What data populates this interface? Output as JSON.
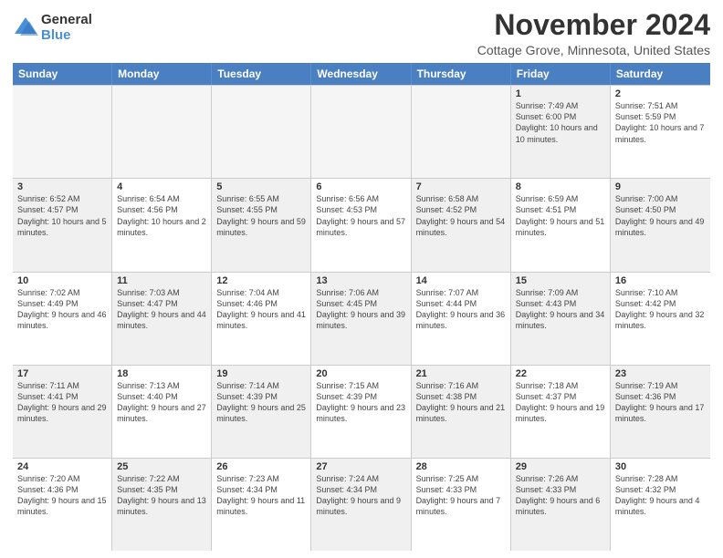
{
  "header": {
    "logo_general": "General",
    "logo_blue": "Blue",
    "month_title": "November 2024",
    "location": "Cottage Grove, Minnesota, United States"
  },
  "days_of_week": [
    "Sunday",
    "Monday",
    "Tuesday",
    "Wednesday",
    "Thursday",
    "Friday",
    "Saturday"
  ],
  "rows": [
    [
      {
        "day": "",
        "info": "",
        "empty": true
      },
      {
        "day": "",
        "info": "",
        "empty": true
      },
      {
        "day": "",
        "info": "",
        "empty": true
      },
      {
        "day": "",
        "info": "",
        "empty": true
      },
      {
        "day": "",
        "info": "",
        "empty": true
      },
      {
        "day": "1",
        "info": "Sunrise: 7:49 AM\nSunset: 6:00 PM\nDaylight: 10 hours and 10 minutes.",
        "shaded": true
      },
      {
        "day": "2",
        "info": "Sunrise: 7:51 AM\nSunset: 5:59 PM\nDaylight: 10 hours and 7 minutes.",
        "shaded": false
      }
    ],
    [
      {
        "day": "3",
        "info": "Sunrise: 6:52 AM\nSunset: 4:57 PM\nDaylight: 10 hours and 5 minutes.",
        "shaded": true
      },
      {
        "day": "4",
        "info": "Sunrise: 6:54 AM\nSunset: 4:56 PM\nDaylight: 10 hours and 2 minutes.",
        "shaded": false
      },
      {
        "day": "5",
        "info": "Sunrise: 6:55 AM\nSunset: 4:55 PM\nDaylight: 9 hours and 59 minutes.",
        "shaded": true
      },
      {
        "day": "6",
        "info": "Sunrise: 6:56 AM\nSunset: 4:53 PM\nDaylight: 9 hours and 57 minutes.",
        "shaded": false
      },
      {
        "day": "7",
        "info": "Sunrise: 6:58 AM\nSunset: 4:52 PM\nDaylight: 9 hours and 54 minutes.",
        "shaded": true
      },
      {
        "day": "8",
        "info": "Sunrise: 6:59 AM\nSunset: 4:51 PM\nDaylight: 9 hours and 51 minutes.",
        "shaded": false
      },
      {
        "day": "9",
        "info": "Sunrise: 7:00 AM\nSunset: 4:50 PM\nDaylight: 9 hours and 49 minutes.",
        "shaded": true
      }
    ],
    [
      {
        "day": "10",
        "info": "Sunrise: 7:02 AM\nSunset: 4:49 PM\nDaylight: 9 hours and 46 minutes.",
        "shaded": false
      },
      {
        "day": "11",
        "info": "Sunrise: 7:03 AM\nSunset: 4:47 PM\nDaylight: 9 hours and 44 minutes.",
        "shaded": true
      },
      {
        "day": "12",
        "info": "Sunrise: 7:04 AM\nSunset: 4:46 PM\nDaylight: 9 hours and 41 minutes.",
        "shaded": false
      },
      {
        "day": "13",
        "info": "Sunrise: 7:06 AM\nSunset: 4:45 PM\nDaylight: 9 hours and 39 minutes.",
        "shaded": true
      },
      {
        "day": "14",
        "info": "Sunrise: 7:07 AM\nSunset: 4:44 PM\nDaylight: 9 hours and 36 minutes.",
        "shaded": false
      },
      {
        "day": "15",
        "info": "Sunrise: 7:09 AM\nSunset: 4:43 PM\nDaylight: 9 hours and 34 minutes.",
        "shaded": true
      },
      {
        "day": "16",
        "info": "Sunrise: 7:10 AM\nSunset: 4:42 PM\nDaylight: 9 hours and 32 minutes.",
        "shaded": false
      }
    ],
    [
      {
        "day": "17",
        "info": "Sunrise: 7:11 AM\nSunset: 4:41 PM\nDaylight: 9 hours and 29 minutes.",
        "shaded": true
      },
      {
        "day": "18",
        "info": "Sunrise: 7:13 AM\nSunset: 4:40 PM\nDaylight: 9 hours and 27 minutes.",
        "shaded": false
      },
      {
        "day": "19",
        "info": "Sunrise: 7:14 AM\nSunset: 4:39 PM\nDaylight: 9 hours and 25 minutes.",
        "shaded": true
      },
      {
        "day": "20",
        "info": "Sunrise: 7:15 AM\nSunset: 4:39 PM\nDaylight: 9 hours and 23 minutes.",
        "shaded": false
      },
      {
        "day": "21",
        "info": "Sunrise: 7:16 AM\nSunset: 4:38 PM\nDaylight: 9 hours and 21 minutes.",
        "shaded": true
      },
      {
        "day": "22",
        "info": "Sunrise: 7:18 AM\nSunset: 4:37 PM\nDaylight: 9 hours and 19 minutes.",
        "shaded": false
      },
      {
        "day": "23",
        "info": "Sunrise: 7:19 AM\nSunset: 4:36 PM\nDaylight: 9 hours and 17 minutes.",
        "shaded": true
      }
    ],
    [
      {
        "day": "24",
        "info": "Sunrise: 7:20 AM\nSunset: 4:36 PM\nDaylight: 9 hours and 15 minutes.",
        "shaded": false
      },
      {
        "day": "25",
        "info": "Sunrise: 7:22 AM\nSunset: 4:35 PM\nDaylight: 9 hours and 13 minutes.",
        "shaded": true
      },
      {
        "day": "26",
        "info": "Sunrise: 7:23 AM\nSunset: 4:34 PM\nDaylight: 9 hours and 11 minutes.",
        "shaded": false
      },
      {
        "day": "27",
        "info": "Sunrise: 7:24 AM\nSunset: 4:34 PM\nDaylight: 9 hours and 9 minutes.",
        "shaded": true
      },
      {
        "day": "28",
        "info": "Sunrise: 7:25 AM\nSunset: 4:33 PM\nDaylight: 9 hours and 7 minutes.",
        "shaded": false
      },
      {
        "day": "29",
        "info": "Sunrise: 7:26 AM\nSunset: 4:33 PM\nDaylight: 9 hours and 6 minutes.",
        "shaded": true
      },
      {
        "day": "30",
        "info": "Sunrise: 7:28 AM\nSunset: 4:32 PM\nDaylight: 9 hours and 4 minutes.",
        "shaded": false
      }
    ]
  ]
}
